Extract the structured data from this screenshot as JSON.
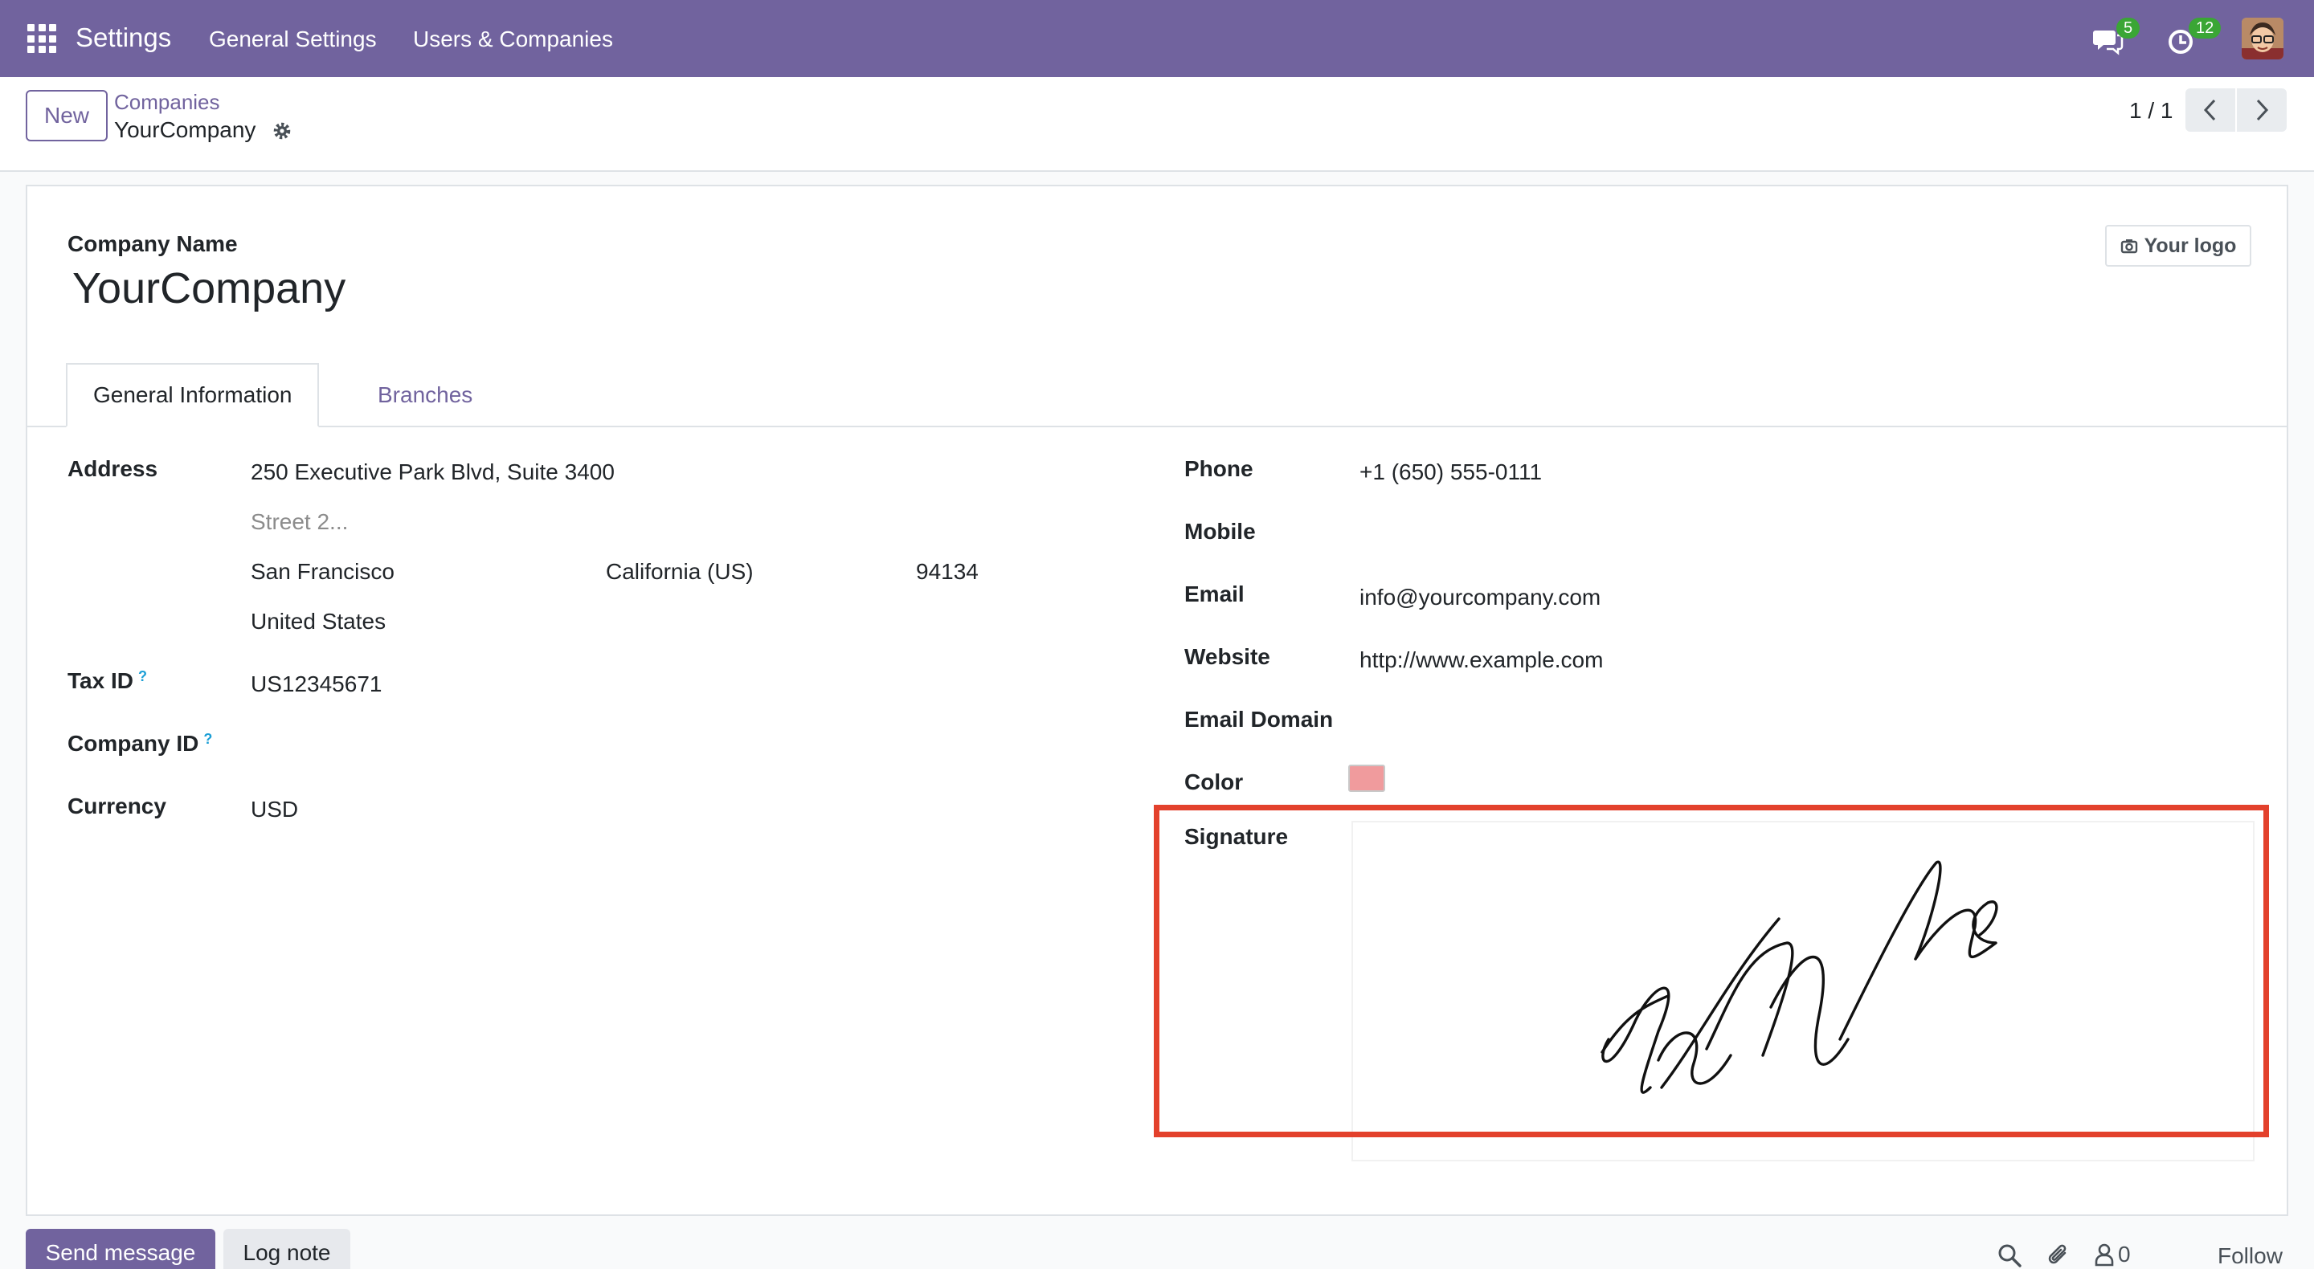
{
  "navbar": {
    "app_title": "Settings",
    "menu": [
      "General Settings",
      "Users & Companies"
    ],
    "messages_count": "5",
    "activities_count": "12",
    "accent": "#71639e"
  },
  "control_panel": {
    "new_label": "New",
    "breadcrumb_parent": "Companies",
    "breadcrumb_current": "YourCompany",
    "pager_value": "1 / 1"
  },
  "form": {
    "company_name_label": "Company Name",
    "company_name": "YourCompany",
    "logo_label": "Your logo",
    "tabs": [
      "General Information",
      "Branches"
    ],
    "left": {
      "address_label": "Address",
      "street": "250 Executive Park Blvd, Suite 3400",
      "street2_placeholder": "Street 2...",
      "city": "San Francisco",
      "state": "California (US)",
      "zip": "94134",
      "country": "United States",
      "tax_id_label": "Tax ID",
      "tax_id": "US12345671",
      "company_id_label": "Company ID",
      "help_mark": "?",
      "currency_label": "Currency",
      "currency": "USD"
    },
    "right": {
      "phone_label": "Phone",
      "phone": "+1 (650) 555-0111",
      "mobile_label": "Mobile",
      "email_label": "Email",
      "email": "info@yourcompany.com",
      "website_label": "Website",
      "website": "http://www.example.com",
      "email_domain_label": "Email Domain",
      "color_label": "Color",
      "color_value": "#f09b9d",
      "signature_label": "Signature"
    }
  },
  "chatter": {
    "send_message_label": "Send message",
    "log_note_label": "Log note",
    "followers_count": "0",
    "follow_label": "Follow"
  },
  "icons": [
    "apps-grid-icon",
    "chat-bubbles-icon",
    "activity-clock-icon",
    "gear-icon",
    "chevron-left-icon",
    "chevron-right-icon",
    "camera-icon",
    "search-icon",
    "paperclip-icon",
    "followers-icon"
  ]
}
